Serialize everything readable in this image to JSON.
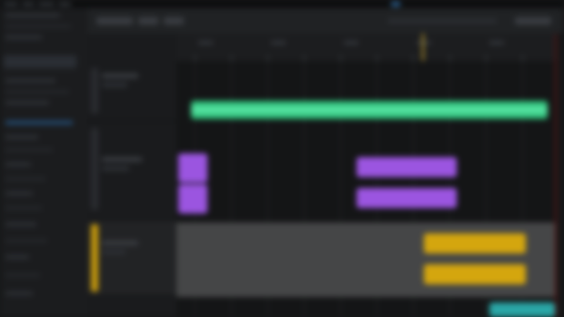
{
  "app": {
    "window_title": "",
    "menu": [],
    "colors": {
      "background": "#161718",
      "panel": "#1b1c1e",
      "audio_clip": "#2fbf7a",
      "midi_clip": "#9b55e0",
      "pattern_clip": "#d4a60e",
      "selected_lane": "#454647",
      "playhead": "#5a1515"
    }
  },
  "browser": {
    "items": []
  },
  "tracks": [
    {
      "name": "",
      "type": "audio"
    },
    {
      "name": "",
      "type": "midi"
    },
    {
      "name": "",
      "type": "pattern"
    }
  ],
  "transport": {
    "tempo": "",
    "position": ""
  }
}
